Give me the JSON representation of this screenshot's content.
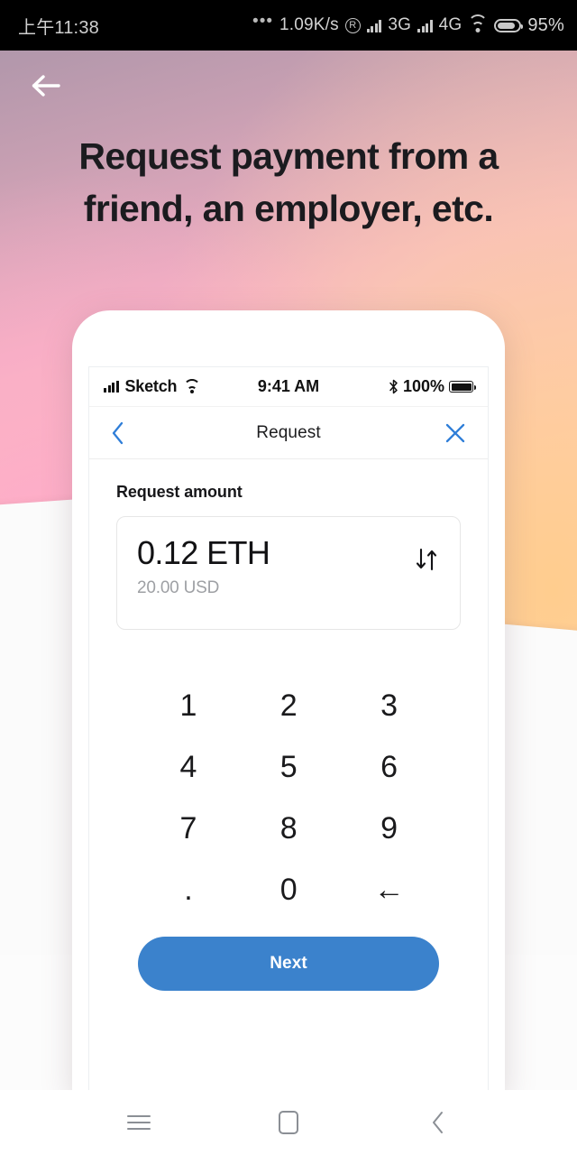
{
  "system_status_bar": {
    "clock": "上午11:38",
    "dots": "•••",
    "network_speed": "1.09K/s",
    "roaming_icon_label": "R",
    "network_type_1": "3G",
    "network_type_2": "4G",
    "battery_percent": "95%",
    "icons": [
      "more-dots-icon",
      "roaming-icon",
      "signal-bars-icon",
      "wifi-icon",
      "battery-icon"
    ]
  },
  "hero": {
    "back_label": "←",
    "title": "Request payment from a friend, an employer, etc.",
    "gradient_colors": [
      "#b197ab",
      "#f3aec4",
      "#ffc3c0",
      "#ffd9a6"
    ]
  },
  "phone": {
    "ios_status": {
      "carrier": "Sketch",
      "time": "9:41 AM",
      "battery_percent": "100%"
    },
    "navbar": {
      "back_label": "‹",
      "title": "Request",
      "close_label": "✕",
      "accent_color": "#2f7ed8"
    },
    "form": {
      "field_label": "Request amount",
      "amount_primary": "0.12 ETH",
      "amount_secondary": "20.00 USD",
      "swap_icon_label": "⇅"
    },
    "keypad": {
      "keys": [
        "1",
        "2",
        "3",
        "4",
        "5",
        "6",
        "7",
        "8",
        "9",
        ".",
        "0",
        "←"
      ]
    },
    "primary_button": {
      "label": "Next",
      "color": "#3b82cc"
    }
  },
  "android_nav": {
    "menu_label": "menu-icon",
    "home_label": "home-icon",
    "back_label": "‹"
  }
}
